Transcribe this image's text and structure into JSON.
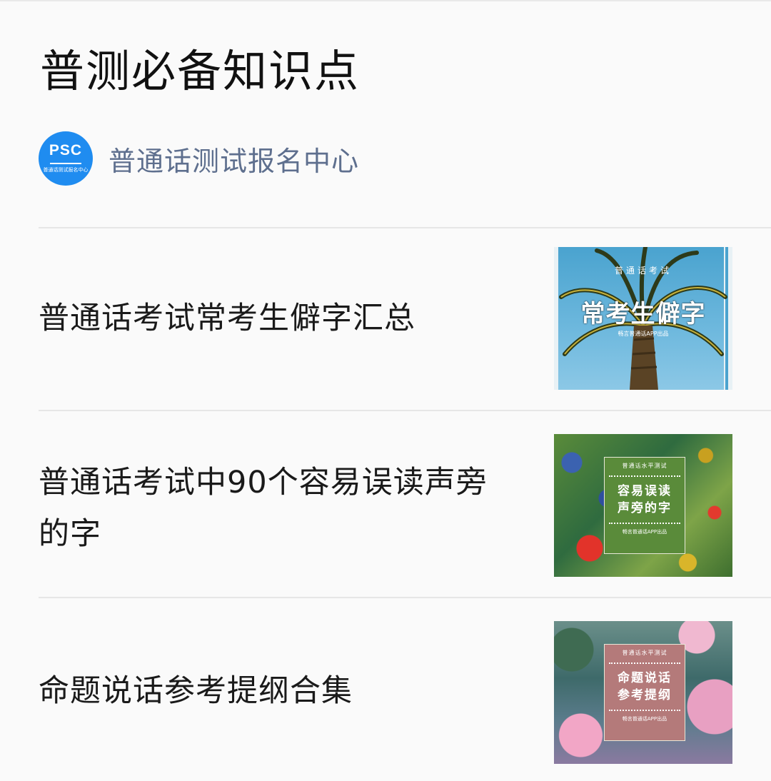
{
  "header": {
    "title": "普测必备知识点"
  },
  "account": {
    "name": "普通话测试报名中心",
    "avatar_text": "PSC",
    "avatar_subtext": "普通话测试报名中心"
  },
  "articles": [
    {
      "title": "普通话考试常考生僻字汇总",
      "thumb": {
        "top_text": "普通话考试",
        "main_text": "常考生僻字",
        "credit": "畅言普通话APP出品"
      }
    },
    {
      "title": "普通话考试中90个容易误读声旁的字",
      "thumb": {
        "top_text": "普通话水平测试",
        "main_line1": "容易误读",
        "main_line2": "声旁的字",
        "credit": "畅言普通话APP出品"
      }
    },
    {
      "title": "命题说话参考提纲合集",
      "thumb": {
        "top_text": "普通话水平测试",
        "main_line1": "命题说话",
        "main_line2": "参考提纲",
        "credit": "畅言普通话APP出品"
      }
    }
  ],
  "colors": {
    "account_name": "#5e6f8e",
    "avatar_bg": "#1f8cf0",
    "divider": "#e6e6e6"
  }
}
